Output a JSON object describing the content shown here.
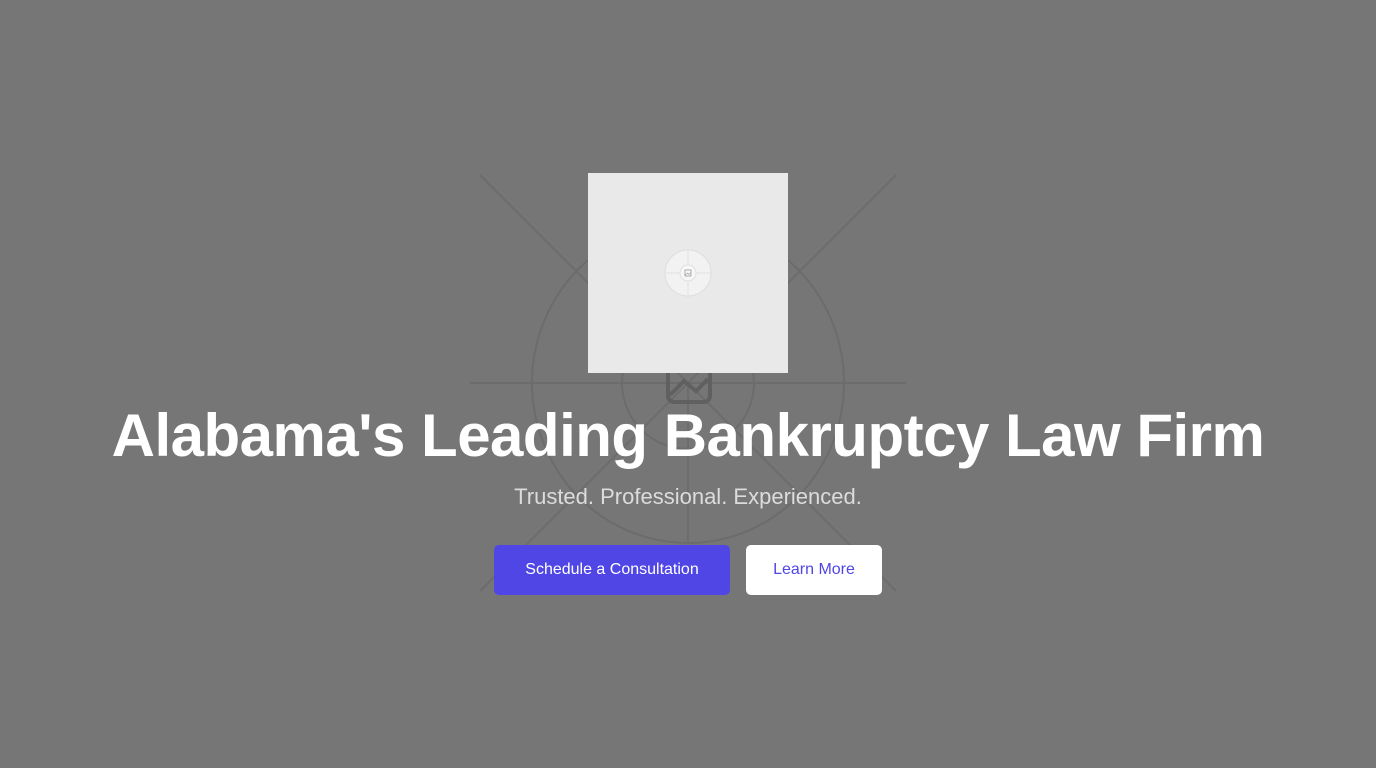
{
  "hero": {
    "background_image_icon": "image-placeholder-icon",
    "logo_icon": "image-placeholder-icon",
    "headline": "Alabama's Leading Bankruptcy Law Firm",
    "tagline": "Trusted. Professional. Experienced.",
    "primary_button": "Schedule a Consultation",
    "secondary_button": "Learn More"
  },
  "colors": {
    "background": "#767676",
    "accent": "#4f46e5",
    "headline": "#ffffff",
    "tagline": "#dcdcdc",
    "logo_box": "#e9e9e9"
  }
}
